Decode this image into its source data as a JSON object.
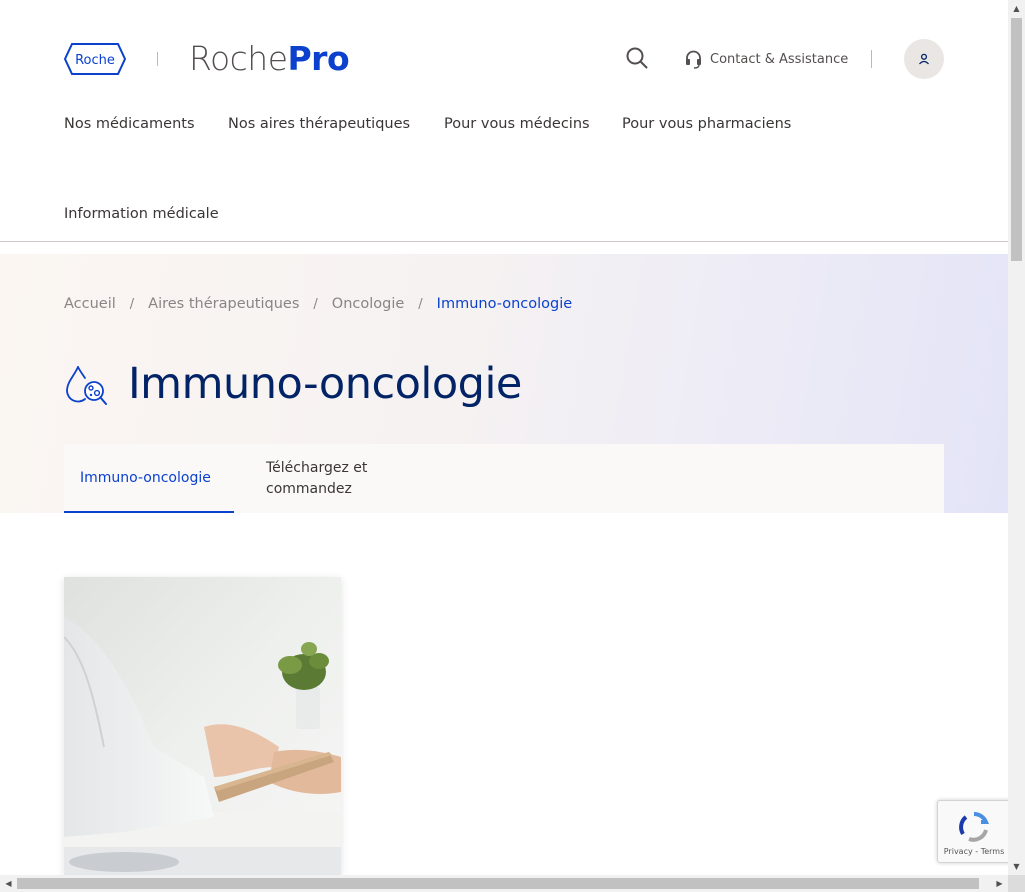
{
  "header": {
    "roche_logo": "Roche",
    "brand_prefix": "Roche",
    "brand_suffix": "Pro",
    "contact_label": "Contact & Assistance",
    "brand_color": "#0b41cd"
  },
  "nav": {
    "items": [
      {
        "label": "Nos médicaments"
      },
      {
        "label": "Nos aires thérapeutiques"
      },
      {
        "label": "Pour vous médecins"
      },
      {
        "label": "Pour vous pharmaciens"
      },
      {
        "label": "Information médicale"
      }
    ]
  },
  "breadcrumb": {
    "items": [
      {
        "label": "Accueil"
      },
      {
        "label": "Aires thérapeutiques"
      },
      {
        "label": "Oncologie"
      },
      {
        "label": "Immuno-oncologie"
      }
    ],
    "separator": "/"
  },
  "page": {
    "title": "Immuno-oncologie",
    "title_icon": "immuno-oncology-icon"
  },
  "tabs": [
    {
      "label": "Immuno-oncologie",
      "active": true
    },
    {
      "label": "Téléchargez et commandez",
      "active": false
    }
  ],
  "recaptcha": {
    "links": "Privacy - Terms"
  }
}
